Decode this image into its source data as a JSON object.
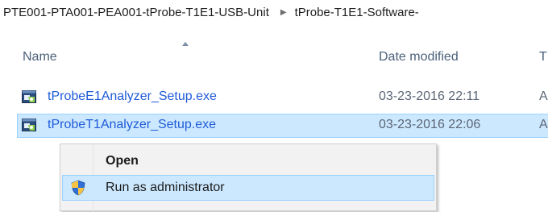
{
  "breadcrumb": {
    "segments": [
      "PTE001-PTA001-PEA001-tProbe-T1E1-USB-Unit",
      "tProbe-T1E1-Software-"
    ],
    "separator": "▶"
  },
  "columns": {
    "name": "Name",
    "date_modified": "Date modified",
    "type": "T",
    "sort_indicator": "ascending"
  },
  "files": [
    {
      "name": "tProbeE1Analyzer_Setup.exe",
      "date_modified": "03-23-2016 22:11",
      "type": "A",
      "icon": "setup-exe-icon",
      "selected": false
    },
    {
      "name": "tProbeT1Analyzer_Setup.exe",
      "date_modified": "03-23-2016 22:06",
      "type": "A",
      "icon": "setup-exe-icon",
      "selected": true
    }
  ],
  "context_menu": {
    "items": [
      {
        "label": "Open",
        "bold": true,
        "icon": null
      },
      {
        "label": "Run as administrator",
        "bold": false,
        "icon": "uac-shield-icon",
        "highlighted": true
      }
    ]
  },
  "colors": {
    "selection_bg": "#cce8ff",
    "selection_border": "#99d1ff",
    "file_name": "#1f5bd8",
    "header_text": "#4c607a",
    "menu_bg": "#f2f2f2"
  }
}
